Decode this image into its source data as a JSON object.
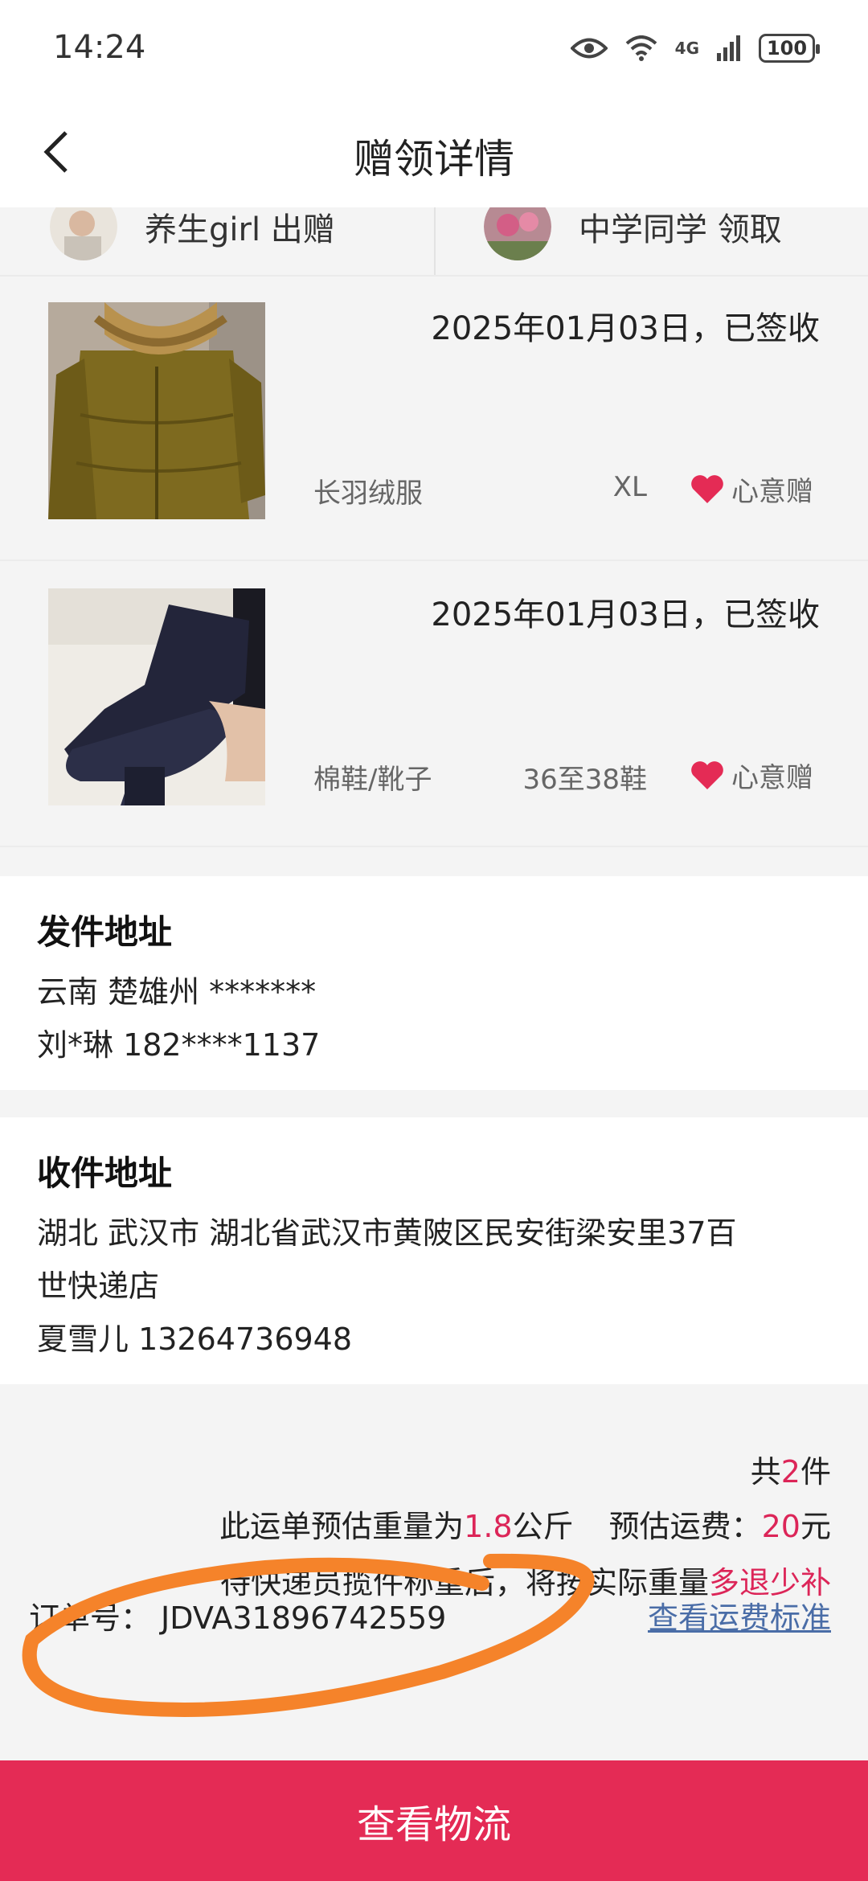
{
  "status_bar": {
    "time": "14:24",
    "network": "4G",
    "battery": "100",
    "icons": [
      "eye-icon",
      "wifi-icon",
      "signal-icon",
      "battery-icon"
    ]
  },
  "nav": {
    "title": "赠领详情",
    "back_icon": "chevron-left-icon"
  },
  "persons": {
    "giver": {
      "name": "养生girl 出赠"
    },
    "receiver": {
      "name": "中学同学 领取"
    }
  },
  "items": [
    {
      "date_status": "2025年01月03日，已签收",
      "name": "长羽绒服",
      "size": "XL",
      "tag": "心意赠"
    },
    {
      "date_status": "2025年01月03日，已签收",
      "name": "棉鞋/靴子",
      "size": "36至38鞋",
      "tag": "心意赠"
    }
  ],
  "sender": {
    "heading": "发件地址",
    "region": "云南 楚雄州 *******",
    "contact": "刘*琳 182****1137"
  },
  "receiver_address": {
    "heading": "收件地址",
    "address_line1": "湖北 武汉市 湖北省武汉市黄陂区民安街梁安里37百",
    "address_line2": "世快递店",
    "contact": "夏雪儿 13264736948"
  },
  "summary": {
    "count_prefix": "共",
    "count": "2",
    "count_suffix": "件",
    "weight_prefix": "此运单预估重量为",
    "weight": "1.8",
    "weight_unit": "公斤",
    "fee_prefix": "预估运费：",
    "fee": "20",
    "fee_unit": "元",
    "note_prefix": "待快递员揽件称重后，将按实际重量",
    "note_highlight": "多退少补",
    "order_label": "订单号：",
    "order_number": "JDVA31896742559",
    "fee_standard_link": "查看运费标准"
  },
  "bottom_button": "查看物流",
  "colors": {
    "accent": "#e42b55",
    "highlight_red": "#dc2558",
    "link_blue": "#4a6da7",
    "annotation_orange": "#f5832a"
  }
}
